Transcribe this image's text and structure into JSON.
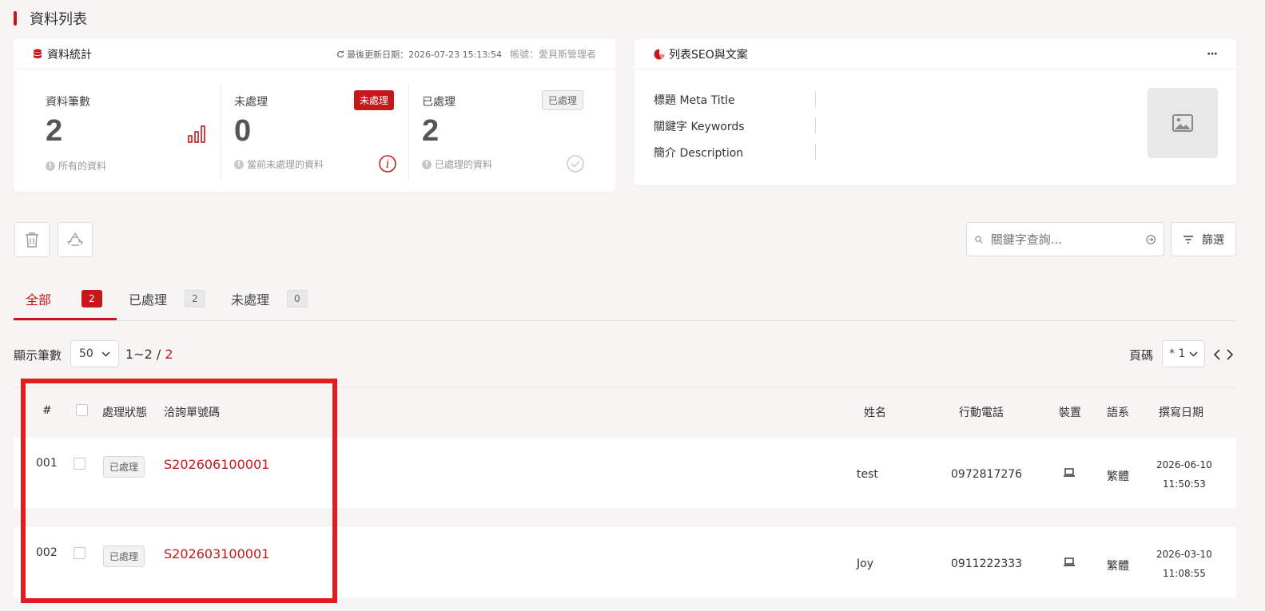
{
  "page": {
    "title": "資料列表"
  },
  "stats_card": {
    "title": "資料統計",
    "updated": "最後更新日期：2026-07-23 15:13:54",
    "account": "帳號：愛貝斯管理者",
    "items": [
      {
        "label": "資料筆數",
        "value": "2",
        "sub": "所有的資料"
      },
      {
        "label": "未處理",
        "value": "0",
        "sub": "當前未處理的資料",
        "badge": "未處理"
      },
      {
        "label": "已處理",
        "value": "2",
        "sub": "已處理的資料",
        "badge": "已處理"
      }
    ]
  },
  "seo_card": {
    "title": "列表SEO與文案",
    "more": "···",
    "rows": [
      "標題 Meta Title",
      "關鍵字 Keywords",
      "簡介 Description"
    ]
  },
  "toolbar": {
    "search_placeholder": "關鍵字查詢...",
    "filter_label": "篩選"
  },
  "tabs": [
    {
      "label": "全部",
      "count": "2"
    },
    {
      "label": "已處理",
      "count": "2"
    },
    {
      "label": "未處理",
      "count": "0"
    }
  ],
  "paging": {
    "show_label": "顯示筆數",
    "per_page": "50",
    "range": "1~2 / ",
    "total": "2",
    "page_label": "頁碼",
    "page_value": "* 1"
  },
  "table": {
    "headers": {
      "index": "#",
      "status": "處理狀態",
      "order_no": "洽詢單號碼",
      "name": "姓名",
      "phone": "行動電話",
      "device": "裝置",
      "lang": "語系",
      "date": "撰寫日期"
    },
    "rows": [
      {
        "index": "001",
        "status": "已處理",
        "order_no": "S202606100001",
        "name": "test",
        "phone": "0972817276",
        "lang": "繁體",
        "date": "2026-06-10",
        "time": "11:50:53"
      },
      {
        "index": "002",
        "status": "已處理",
        "order_no": "S202603100001",
        "name": "Joy",
        "phone": "0911222333",
        "lang": "繁體",
        "date": "2026-03-10",
        "time": "11:08:55"
      }
    ]
  },
  "colors": {
    "accent": "#c8171b",
    "highlight": "#e11d22"
  }
}
